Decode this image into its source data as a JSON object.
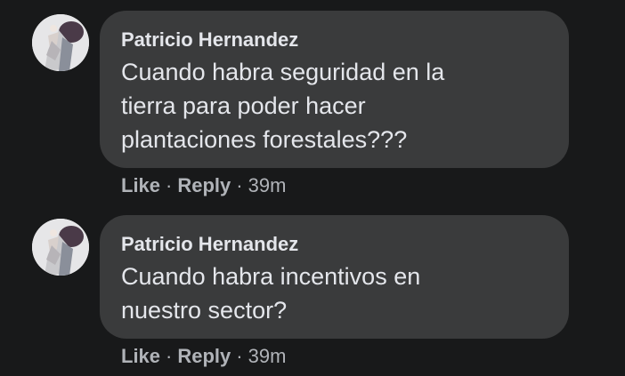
{
  "comments": [
    {
      "author": "Patricio Hernandez",
      "text": "Cuando habra seguridad en la\ntierra para poder hacer\nplantaciones forestales???",
      "like_label": "Like",
      "reply_label": "Reply",
      "separator": "·",
      "time": "39m",
      "avatar_icon": "profile-photo-icon"
    },
    {
      "author": "Patricio Hernandez",
      "text": "Cuando habra incentivos en\nnuestro sector?",
      "like_label": "Like",
      "reply_label": "Reply",
      "separator": "·",
      "time": "39m",
      "avatar_icon": "profile-photo-icon"
    }
  ],
  "colors": {
    "background": "#18191a",
    "bubble": "#3a3b3c",
    "primary_text": "#e4e6eb",
    "secondary_text": "#b0b3b8"
  }
}
